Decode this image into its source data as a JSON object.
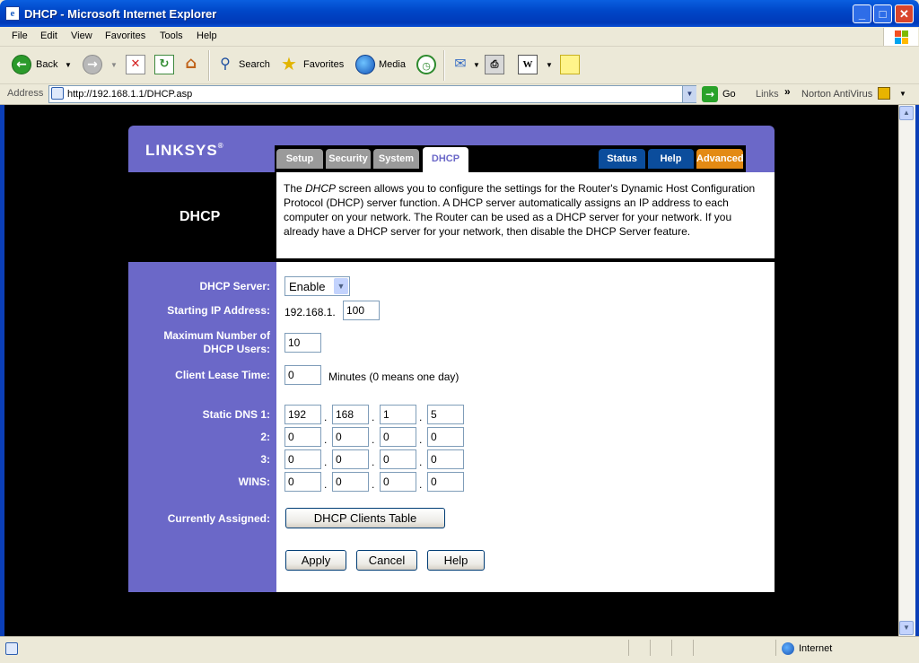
{
  "window": {
    "title": "DHCP - Microsoft Internet Explorer",
    "minimize": "_",
    "maximize": "□",
    "close": "✕"
  },
  "menu": [
    "File",
    "Edit",
    "View",
    "Favorites",
    "Tools",
    "Help"
  ],
  "toolbar": {
    "back": "Back",
    "search": "Search",
    "favorites": "Favorites",
    "media": "Media"
  },
  "address": {
    "label": "Address",
    "url": "http://192.168.1.1/DHCP.asp",
    "go": "Go",
    "links": "Links",
    "links_chevron": "»",
    "norton": "Norton AntiVirus"
  },
  "page": {
    "logo": "LINKSYS",
    "logo_mark": "®",
    "tabs": [
      {
        "label": "Setup"
      },
      {
        "label": "Security"
      },
      {
        "label": "System"
      },
      {
        "label": "DHCP"
      },
      {
        "label": "Status"
      },
      {
        "label": "Help"
      },
      {
        "label": "Advanced"
      }
    ],
    "section_title": "DHCP",
    "description_pre": "The ",
    "description_em": "DHCP",
    "description_post": " screen allows you to configure the settings for the Router's Dynamic Host Configuration Protocol (DHCP) server function. A DHCP server automatically assigns an IP address to each computer on your network. The Router can be used as a DHCP server for your network. If you already have a DHCP server for your network, then disable the DHCP Server feature.",
    "labels": {
      "dhcp_server": "DHCP Server:",
      "starting_ip": "Starting IP Address:",
      "max_users_1": "Maximum Number of",
      "max_users_2": "DHCP Users:",
      "lease_time": "Client Lease Time:",
      "dns1": "Static DNS 1:",
      "dns2": "2:",
      "dns3": "3:",
      "wins": "WINS:",
      "assigned": "Currently Assigned:"
    },
    "dhcp_server_value": "Enable",
    "ip_prefix": "192.168.1.",
    "starting_ip_value": "100",
    "max_users_value": "10",
    "lease_time_value": "0",
    "lease_note": "Minutes (0 means one day)",
    "dns1": [
      "192",
      "168",
      "1",
      "5"
    ],
    "dns2": [
      "0",
      "0",
      "0",
      "0"
    ],
    "dns3": [
      "0",
      "0",
      "0",
      "0"
    ],
    "wins": [
      "0",
      "0",
      "0",
      "0"
    ],
    "octet_separator": ".",
    "clients_table_button": "DHCP Clients Table",
    "apply_button": "Apply",
    "cancel_button": "Cancel",
    "help_button": "Help"
  },
  "status": {
    "zone": "Internet"
  },
  "colors": {
    "linksys_purple": "#6b68c8",
    "tab_blue": "#0b4d9c",
    "tab_orange": "#e38a14",
    "xp_titlebar": "#0047c8"
  }
}
